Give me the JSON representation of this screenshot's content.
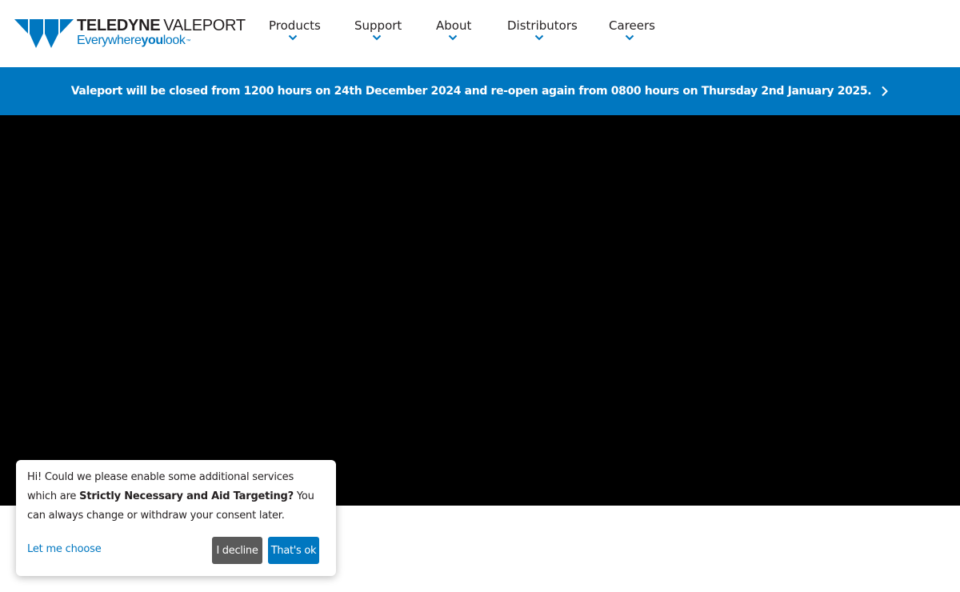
{
  "brand": {
    "name_bold": "TELEDYNE",
    "name_light": "VALEPORT",
    "tagline_part1": "Everywhere",
    "tagline_part2": "you",
    "tagline_part3": "look",
    "tagline_mark": "™",
    "color": "#0077c0"
  },
  "nav": {
    "items": [
      {
        "label": "Products"
      },
      {
        "label": "Support"
      },
      {
        "label": "About"
      },
      {
        "label": "Distributors"
      },
      {
        "label": "Careers"
      }
    ],
    "chevron_icon": "chevron-down-icon"
  },
  "notice": {
    "text": "Valeport will be closed from 1200 hours on 24th December 2024 and re-open again from 0800 hours on Thursday 2nd January 2025.",
    "arrow_icon": "chevron-right-icon",
    "background": "#0077c0"
  },
  "cookie": {
    "text_before": "Hi! Could we please enable some additional services which are ",
    "text_bold": "Strictly Necessary and Aid Targeting?",
    "text_after": " You can always change or withdraw your consent later.",
    "choose_label": "Let me choose",
    "decline_label": "I decline",
    "accept_label": "That's ok"
  }
}
